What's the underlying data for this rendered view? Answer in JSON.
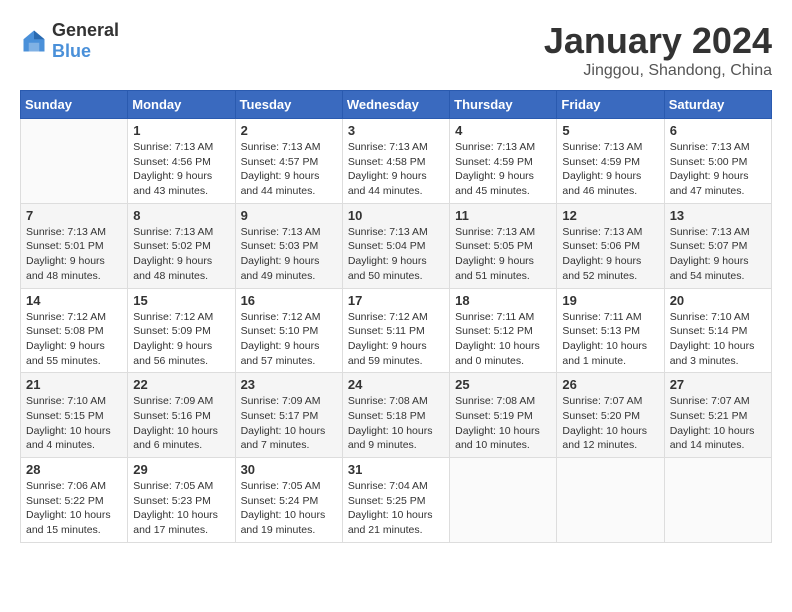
{
  "logo": {
    "general": "General",
    "blue": "Blue"
  },
  "title": {
    "month": "January 2024",
    "location": "Jinggou, Shandong, China"
  },
  "weekdays": [
    "Sunday",
    "Monday",
    "Tuesday",
    "Wednesday",
    "Thursday",
    "Friday",
    "Saturday"
  ],
  "weeks": [
    [
      {
        "day": "",
        "sunrise": "",
        "sunset": "",
        "daylight": ""
      },
      {
        "day": "1",
        "sunrise": "Sunrise: 7:13 AM",
        "sunset": "Sunset: 4:56 PM",
        "daylight": "Daylight: 9 hours and 43 minutes."
      },
      {
        "day": "2",
        "sunrise": "Sunrise: 7:13 AM",
        "sunset": "Sunset: 4:57 PM",
        "daylight": "Daylight: 9 hours and 44 minutes."
      },
      {
        "day": "3",
        "sunrise": "Sunrise: 7:13 AM",
        "sunset": "Sunset: 4:58 PM",
        "daylight": "Daylight: 9 hours and 44 minutes."
      },
      {
        "day": "4",
        "sunrise": "Sunrise: 7:13 AM",
        "sunset": "Sunset: 4:59 PM",
        "daylight": "Daylight: 9 hours and 45 minutes."
      },
      {
        "day": "5",
        "sunrise": "Sunrise: 7:13 AM",
        "sunset": "Sunset: 4:59 PM",
        "daylight": "Daylight: 9 hours and 46 minutes."
      },
      {
        "day": "6",
        "sunrise": "Sunrise: 7:13 AM",
        "sunset": "Sunset: 5:00 PM",
        "daylight": "Daylight: 9 hours and 47 minutes."
      }
    ],
    [
      {
        "day": "7",
        "sunrise": "Sunrise: 7:13 AM",
        "sunset": "Sunset: 5:01 PM",
        "daylight": "Daylight: 9 hours and 48 minutes."
      },
      {
        "day": "8",
        "sunrise": "Sunrise: 7:13 AM",
        "sunset": "Sunset: 5:02 PM",
        "daylight": "Daylight: 9 hours and 48 minutes."
      },
      {
        "day": "9",
        "sunrise": "Sunrise: 7:13 AM",
        "sunset": "Sunset: 5:03 PM",
        "daylight": "Daylight: 9 hours and 49 minutes."
      },
      {
        "day": "10",
        "sunrise": "Sunrise: 7:13 AM",
        "sunset": "Sunset: 5:04 PM",
        "daylight": "Daylight: 9 hours and 50 minutes."
      },
      {
        "day": "11",
        "sunrise": "Sunrise: 7:13 AM",
        "sunset": "Sunset: 5:05 PM",
        "daylight": "Daylight: 9 hours and 51 minutes."
      },
      {
        "day": "12",
        "sunrise": "Sunrise: 7:13 AM",
        "sunset": "Sunset: 5:06 PM",
        "daylight": "Daylight: 9 hours and 52 minutes."
      },
      {
        "day": "13",
        "sunrise": "Sunrise: 7:13 AM",
        "sunset": "Sunset: 5:07 PM",
        "daylight": "Daylight: 9 hours and 54 minutes."
      }
    ],
    [
      {
        "day": "14",
        "sunrise": "Sunrise: 7:12 AM",
        "sunset": "Sunset: 5:08 PM",
        "daylight": "Daylight: 9 hours and 55 minutes."
      },
      {
        "day": "15",
        "sunrise": "Sunrise: 7:12 AM",
        "sunset": "Sunset: 5:09 PM",
        "daylight": "Daylight: 9 hours and 56 minutes."
      },
      {
        "day": "16",
        "sunrise": "Sunrise: 7:12 AM",
        "sunset": "Sunset: 5:10 PM",
        "daylight": "Daylight: 9 hours and 57 minutes."
      },
      {
        "day": "17",
        "sunrise": "Sunrise: 7:12 AM",
        "sunset": "Sunset: 5:11 PM",
        "daylight": "Daylight: 9 hours and 59 minutes."
      },
      {
        "day": "18",
        "sunrise": "Sunrise: 7:11 AM",
        "sunset": "Sunset: 5:12 PM",
        "daylight": "Daylight: 10 hours and 0 minutes."
      },
      {
        "day": "19",
        "sunrise": "Sunrise: 7:11 AM",
        "sunset": "Sunset: 5:13 PM",
        "daylight": "Daylight: 10 hours and 1 minute."
      },
      {
        "day": "20",
        "sunrise": "Sunrise: 7:10 AM",
        "sunset": "Sunset: 5:14 PM",
        "daylight": "Daylight: 10 hours and 3 minutes."
      }
    ],
    [
      {
        "day": "21",
        "sunrise": "Sunrise: 7:10 AM",
        "sunset": "Sunset: 5:15 PM",
        "daylight": "Daylight: 10 hours and 4 minutes."
      },
      {
        "day": "22",
        "sunrise": "Sunrise: 7:09 AM",
        "sunset": "Sunset: 5:16 PM",
        "daylight": "Daylight: 10 hours and 6 minutes."
      },
      {
        "day": "23",
        "sunrise": "Sunrise: 7:09 AM",
        "sunset": "Sunset: 5:17 PM",
        "daylight": "Daylight: 10 hours and 7 minutes."
      },
      {
        "day": "24",
        "sunrise": "Sunrise: 7:08 AM",
        "sunset": "Sunset: 5:18 PM",
        "daylight": "Daylight: 10 hours and 9 minutes."
      },
      {
        "day": "25",
        "sunrise": "Sunrise: 7:08 AM",
        "sunset": "Sunset: 5:19 PM",
        "daylight": "Daylight: 10 hours and 10 minutes."
      },
      {
        "day": "26",
        "sunrise": "Sunrise: 7:07 AM",
        "sunset": "Sunset: 5:20 PM",
        "daylight": "Daylight: 10 hours and 12 minutes."
      },
      {
        "day": "27",
        "sunrise": "Sunrise: 7:07 AM",
        "sunset": "Sunset: 5:21 PM",
        "daylight": "Daylight: 10 hours and 14 minutes."
      }
    ],
    [
      {
        "day": "28",
        "sunrise": "Sunrise: 7:06 AM",
        "sunset": "Sunset: 5:22 PM",
        "daylight": "Daylight: 10 hours and 15 minutes."
      },
      {
        "day": "29",
        "sunrise": "Sunrise: 7:05 AM",
        "sunset": "Sunset: 5:23 PM",
        "daylight": "Daylight: 10 hours and 17 minutes."
      },
      {
        "day": "30",
        "sunrise": "Sunrise: 7:05 AM",
        "sunset": "Sunset: 5:24 PM",
        "daylight": "Daylight: 10 hours and 19 minutes."
      },
      {
        "day": "31",
        "sunrise": "Sunrise: 7:04 AM",
        "sunset": "Sunset: 5:25 PM",
        "daylight": "Daylight: 10 hours and 21 minutes."
      },
      {
        "day": "",
        "sunrise": "",
        "sunset": "",
        "daylight": ""
      },
      {
        "day": "",
        "sunrise": "",
        "sunset": "",
        "daylight": ""
      },
      {
        "day": "",
        "sunrise": "",
        "sunset": "",
        "daylight": ""
      }
    ]
  ]
}
